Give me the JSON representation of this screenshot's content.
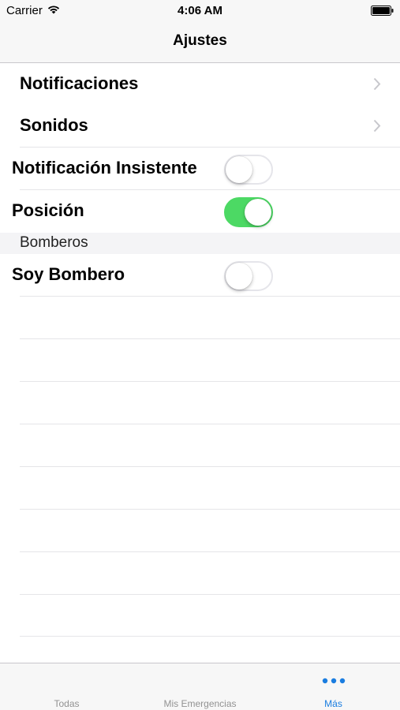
{
  "status_bar": {
    "carrier": "Carrier",
    "time": "4:06 AM",
    "wifi_icon": "wifi-icon",
    "battery_icon": "battery-icon"
  },
  "nav": {
    "title": "Ajustes"
  },
  "rows": [
    {
      "label": "Notificaciones",
      "accessory": "chevron-right-icon"
    },
    {
      "label": "Sonidos",
      "accessory": "chevron-right-icon"
    },
    {
      "label": "Notificación Insistente",
      "toggle_on": false
    },
    {
      "label": "Posición",
      "toggle_on": true
    }
  ],
  "section": {
    "header": "Bomberos",
    "rows": [
      {
        "label": "Soy Bombero",
        "toggle_on": false
      }
    ]
  },
  "tab_bar": {
    "tabs": [
      {
        "label": "Todas",
        "active": false
      },
      {
        "label": "Mis Emergencias",
        "active": false
      },
      {
        "label": "Más",
        "active": true,
        "icon": "more-icon"
      }
    ]
  },
  "colors": {
    "toggle_on": "#4cd964",
    "accent": "#1a7de0",
    "tab_inactive": "#929292"
  }
}
